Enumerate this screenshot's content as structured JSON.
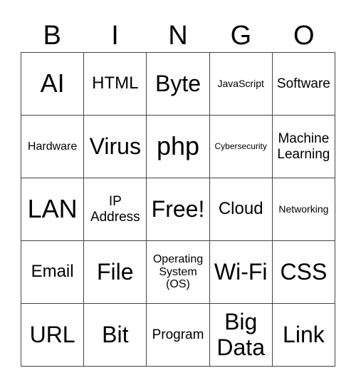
{
  "header": {
    "letters": [
      "B",
      "I",
      "N",
      "G",
      "O"
    ]
  },
  "grid": {
    "rows": [
      [
        "AI",
        "HTML",
        "Byte",
        "JavaScript",
        "Software"
      ],
      [
        "Hardware",
        "Virus",
        "php",
        "Cybersecurity",
        "Machine Learning"
      ],
      [
        "LAN",
        "IP Address",
        "Free!",
        "Cloud",
        "Networking"
      ],
      [
        "Email",
        "File",
        "Operating System (OS)",
        "Wi-Fi",
        "CSS"
      ],
      [
        "URL",
        "Bit",
        "Program",
        "Big Data",
        "Link"
      ]
    ]
  }
}
